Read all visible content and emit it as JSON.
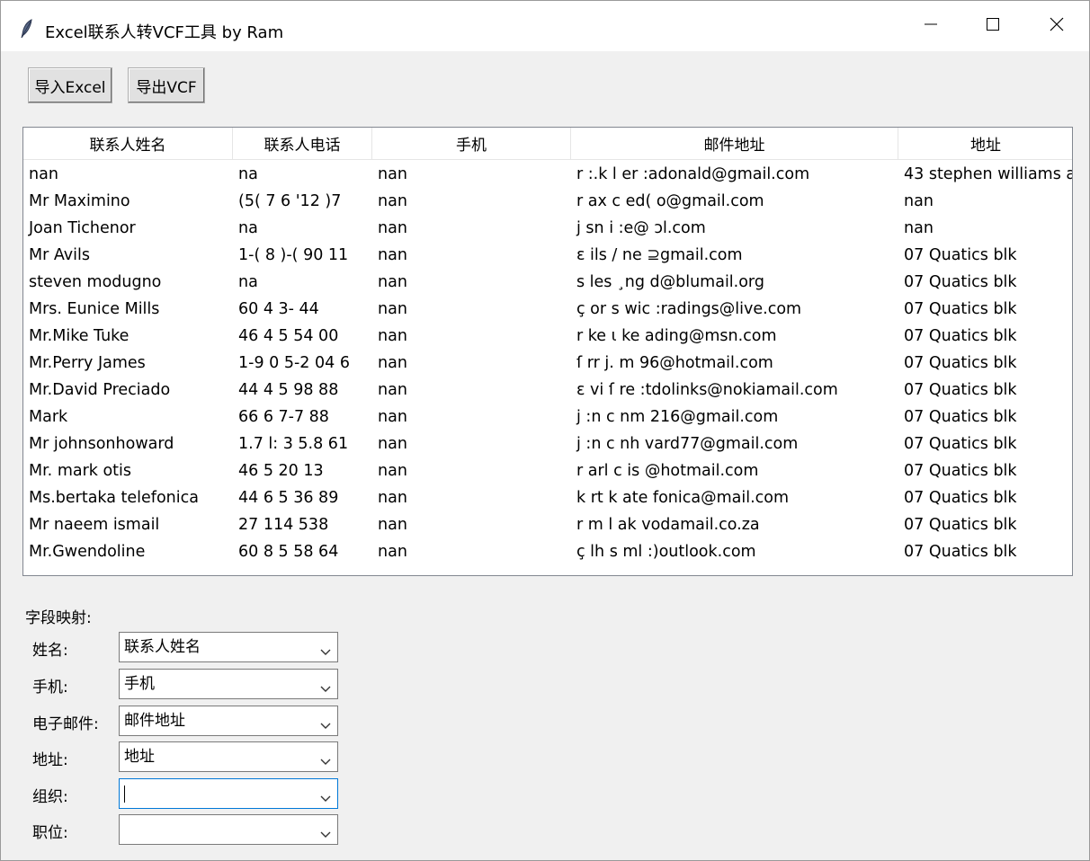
{
  "window": {
    "title": "Excel联系人转VCF工具 by Ram"
  },
  "toolbar": {
    "import_label": "导入Excel",
    "export_label": "导出VCF"
  },
  "table": {
    "columns": [
      "联系人姓名",
      "联系人电话",
      "手机",
      "邮件地址",
      "地址"
    ],
    "rows": [
      [
        "nan",
        "na",
        "nan",
        "r :.k l er :adonald@gmail.com",
        "43 stephen williams a"
      ],
      [
        "Mr Maximino",
        "(5( 7 6 '12 )7",
        "nan",
        "r ax c ed( o@gmail.com",
        "nan"
      ],
      [
        "Joan Tichenor",
        "na",
        "nan",
        "j sn i :e@ ɔl.com",
        "nan"
      ],
      [
        "Mr Avils",
        "1-( 8 )-( 90 11",
        "nan",
        "ε ils / ne ⊇gmail.com",
        "07 Quatics blk"
      ],
      [
        "steven modugno",
        "na",
        "nan",
        "s les ¸ng d@blumail.org",
        "07 Quatics blk"
      ],
      [
        "Mrs. Eunice Mills",
        "60 4 3- 44",
        "nan",
        "ç or s wic :radings@live.com",
        "07 Quatics blk"
      ],
      [
        "Mr.Mike Tuke",
        "46 4 5 54 00",
        "nan",
        "r ke ι ke ading@msn.com",
        "07 Quatics blk"
      ],
      [
        "Mr.Perry James",
        "1-9 0 5-2 04 6",
        "nan",
        "ſ rr j. m 96@hotmail.com",
        "07 Quatics blk"
      ],
      [
        "Mr.David Preciado",
        "44 4 5 98 88",
        "nan",
        "ɛ vi ſ re :tdolinks@nokiamail.com",
        "07 Quatics blk"
      ],
      [
        "Mark",
        "66 6 7-7 88",
        "nan",
        "j :n c nm 216@gmail.com",
        "07 Quatics blk"
      ],
      [
        "Mr johnsonhoward",
        "1.7 l: 3 5.8 61",
        "nan",
        "j :n c nh vard77@gmail.com",
        "07 Quatics blk"
      ],
      [
        "Mr. mark otis",
        "46 5 20 13",
        "nan",
        "r arl c is @hotmail.com",
        "07 Quatics blk"
      ],
      [
        "Ms.bertaka telefonica",
        "44 6 5 36 89",
        "nan",
        "k rt k ate fonica@mail.com",
        "07 Quatics blk"
      ],
      [
        "Mr naeem ismail",
        "27 114 538",
        "nan",
        "r m l ak vodamail.co.za",
        "07 Quatics blk"
      ],
      [
        "Mr.Gwendoline",
        "60 8 5 58 64",
        "nan",
        "ç lh s ml :)outlook.com",
        "07 Quatics blk"
      ]
    ]
  },
  "mapping": {
    "title": "字段映射:",
    "fields": [
      {
        "label": "姓名:",
        "value": "联系人姓名"
      },
      {
        "label": "手机:",
        "value": "手机"
      },
      {
        "label": "电子邮件:",
        "value": "邮件地址"
      },
      {
        "label": "地址:",
        "value": "地址"
      },
      {
        "label": "组织:",
        "value": ""
      },
      {
        "label": "职位:",
        "value": ""
      }
    ]
  },
  "icons": {
    "app": "feather-icon",
    "minimize": "minimize-icon",
    "maximize": "maximize-icon",
    "close": "close-icon",
    "dropdown": "chevron-down-icon"
  }
}
